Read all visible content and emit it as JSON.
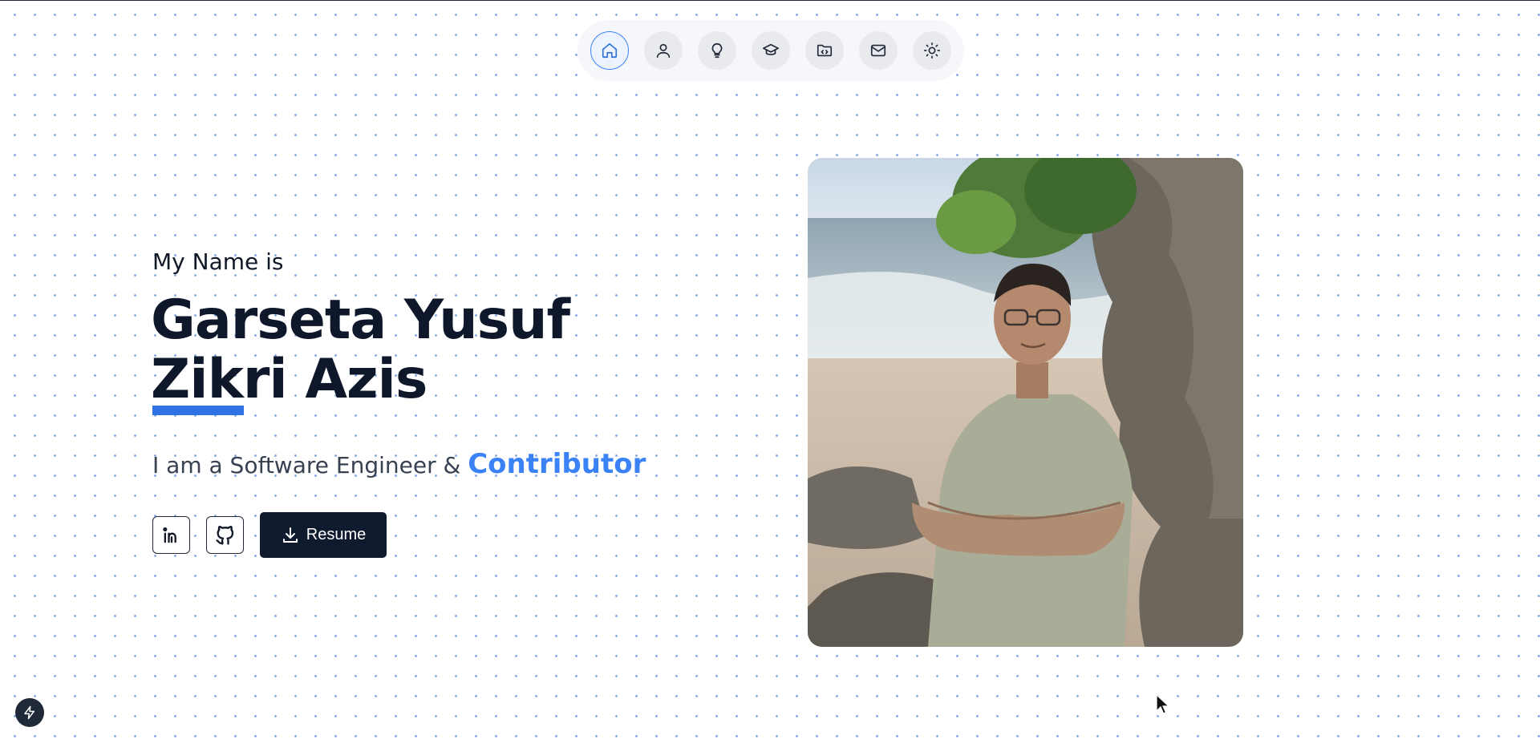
{
  "nav": {
    "items": [
      {
        "id": "home",
        "icon": "home-icon",
        "active": true
      },
      {
        "id": "about",
        "icon": "user-icon",
        "active": false
      },
      {
        "id": "skills",
        "icon": "lightbulb-icon",
        "active": false
      },
      {
        "id": "education",
        "icon": "graduation-cap-icon",
        "active": false
      },
      {
        "id": "projects",
        "icon": "folder-code-icon",
        "active": false
      },
      {
        "id": "contact",
        "icon": "mail-icon",
        "active": false
      },
      {
        "id": "theme",
        "icon": "sun-icon",
        "active": false
      }
    ]
  },
  "hero": {
    "intro": "My Name is",
    "name_line1": "Garseta Yusuf",
    "name_line2": "Zikri Azis",
    "role_prefix": "I am a Software Engineer & ",
    "role_highlight": "Contributor"
  },
  "actions": {
    "linkedin_icon": "linkedin-icon",
    "github_icon": "github-icon",
    "resume_label": "Resume"
  },
  "colors": {
    "accent": "#3b82f6",
    "dark": "#0f172a",
    "dot_grid": "#7ea6e0"
  }
}
